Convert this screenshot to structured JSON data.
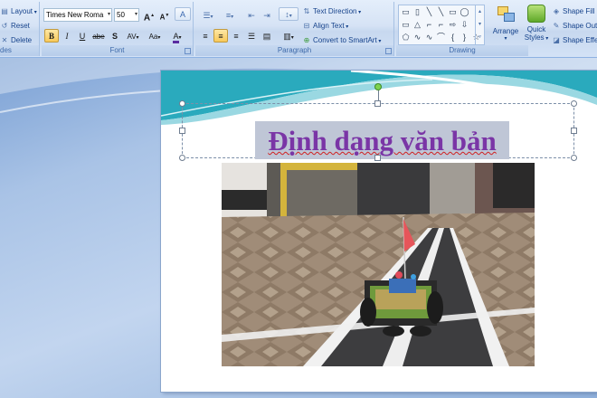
{
  "ribbon": {
    "slides": {
      "layout": "Layout",
      "reset": "Reset",
      "delete": "Delete",
      "group_label": "des"
    },
    "font": {
      "font_name": "Times New Roma",
      "font_size": "50",
      "grow": "A",
      "shrink": "A",
      "clear": "A",
      "bold": "B",
      "italic": "I",
      "underline": "U",
      "strike": "abe",
      "shadow": "S",
      "spacing": "AV",
      "case": "Aa",
      "color": "A",
      "group_label": "Font"
    },
    "paragraph": {
      "text_direction": "Text Direction",
      "align_text": "Align Text",
      "convert_smartart": "Convert to SmartArt",
      "group_label": "Paragraph"
    },
    "drawing": {
      "arrange": "Arrange",
      "quick_styles_1": "Quick",
      "quick_styles_2": "Styles",
      "shape_fill": "Shape Fill",
      "shape_outline": "Shape Outline",
      "shape_effects": "Shape Effects",
      "group_label": "Drawing"
    }
  },
  "slide": {
    "title": "Định dạng văn bản"
  },
  "colors": {
    "accent": "#7ed34f",
    "title": "#7a35a6",
    "ribbon": "#d6e3f5"
  }
}
